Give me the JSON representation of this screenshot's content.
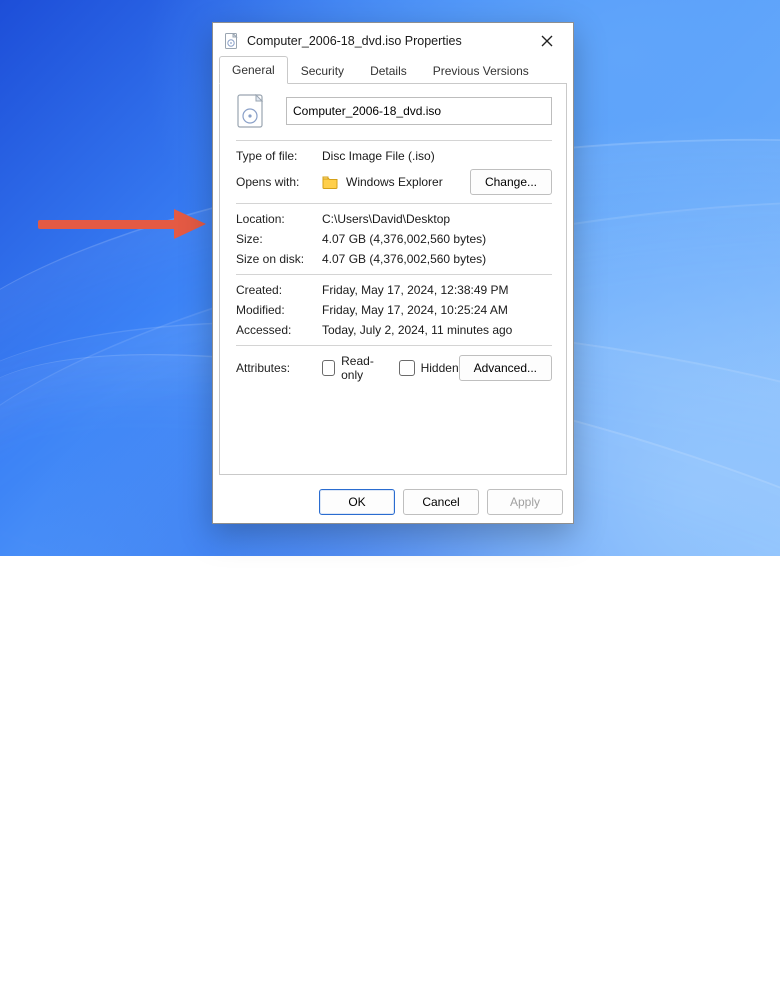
{
  "window": {
    "title": "Computer_2006-18_dvd.iso Properties"
  },
  "tabs": {
    "general": "General",
    "security": "Security",
    "details": "Details",
    "previous_versions": "Previous Versions"
  },
  "general": {
    "filename": "Computer_2006-18_dvd.iso",
    "type_label": "Type of file:",
    "type_value": "Disc Image File (.iso)",
    "opens_label": "Opens with:",
    "opens_value": "Windows Explorer",
    "change_label": "Change...",
    "location_label": "Location:",
    "location_value": "C:\\Users\\David\\Desktop",
    "size_label": "Size:",
    "size_value": "4.07 GB (4,376,002,560 bytes)",
    "sizeondisk_label": "Size on disk:",
    "sizeondisk_value": "4.07 GB (4,376,002,560 bytes)",
    "created_label": "Created:",
    "created_value": "Friday, May 17, 2024, 12:38:49 PM",
    "modified_label": "Modified:",
    "modified_value": "Friday, May 17, 2024, 10:25:24 AM",
    "accessed_label": "Accessed:",
    "accessed_value": "Today, July 2, 2024, 11 minutes ago",
    "attributes_label": "Attributes:",
    "readonly_label": "Read-only",
    "hidden_label": "Hidden",
    "advanced_label": "Advanced..."
  },
  "buttons": {
    "ok": "OK",
    "cancel": "Cancel",
    "apply": "Apply"
  }
}
